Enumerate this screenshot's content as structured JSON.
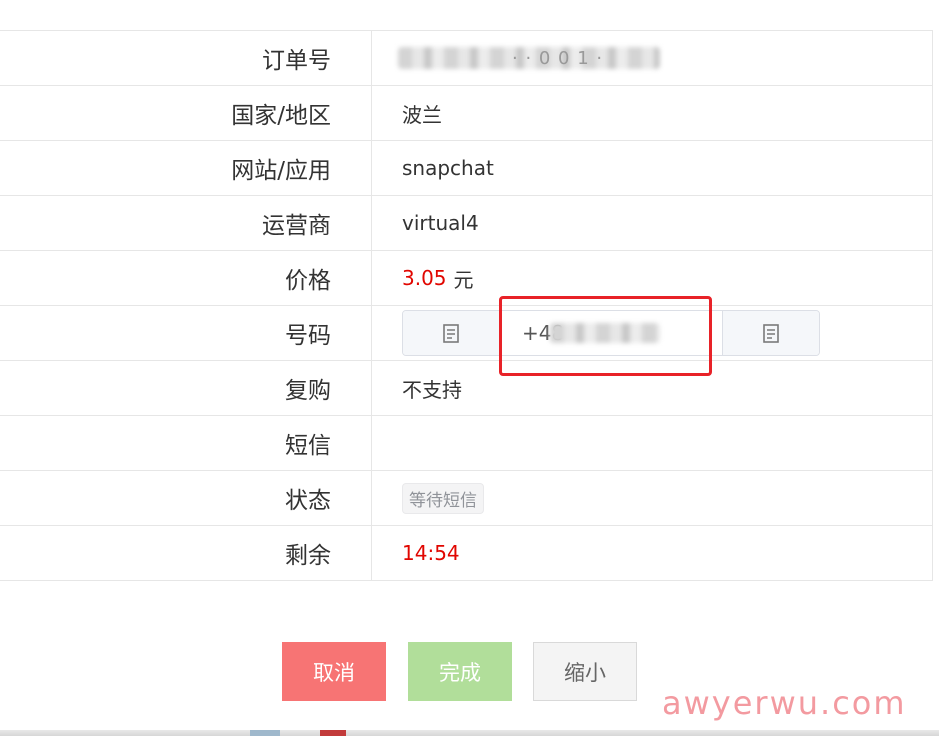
{
  "rows": {
    "order_no": {
      "label": "订单号",
      "value_tail": "· ·  0 0 1 ·"
    },
    "country": {
      "label": "国家/地区",
      "value": "波兰"
    },
    "site": {
      "label": "网站/应用",
      "value": "snapchat"
    },
    "carrier": {
      "label": "运营商",
      "value": "virtual4"
    },
    "price": {
      "label": "价格",
      "amount": "3.05",
      "unit": "元"
    },
    "number": {
      "label": "号码",
      "value_prefix": "+48"
    },
    "repurchase": {
      "label": "复购",
      "value": "不支持"
    },
    "sms": {
      "label": "短信",
      "value": ""
    },
    "status": {
      "label": "状态",
      "value": "等待短信"
    },
    "remaining": {
      "label": "剩余",
      "value": "14:54"
    }
  },
  "buttons": {
    "cancel": "取消",
    "done": "完成",
    "minimize": "缩小"
  },
  "watermark": "awyerwu.com",
  "colors": {
    "accent_red": "#e10600",
    "highlight": "#e82228",
    "cancel_bg": "#f77474",
    "done_bg": "#b1de9a"
  },
  "icons": {
    "copy": "copy-icon"
  }
}
